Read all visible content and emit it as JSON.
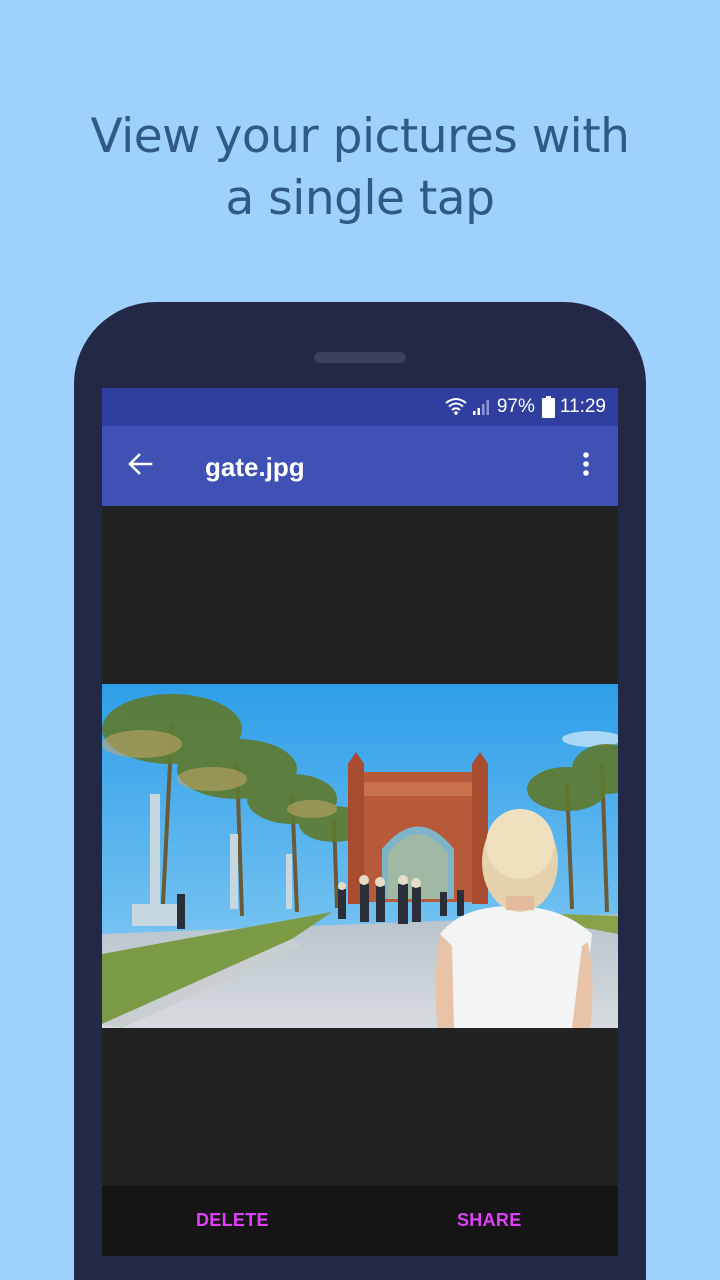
{
  "promo": {
    "line1": "View your pictures with",
    "line2": "a single tap"
  },
  "status_bar": {
    "battery_level": "97%",
    "time": "11:29",
    "icons": [
      "wifi-icon",
      "signal-icon",
      "battery-icon"
    ]
  },
  "app_bar": {
    "title": "gate.jpg",
    "back_icon": "arrow-back-icon",
    "menu_icon": "more-vert-icon"
  },
  "bottom_actions": {
    "delete_label": "DELETE",
    "share_label": "SHARE"
  },
  "colors": {
    "background": "#9fd1fd",
    "headline": "#2f5a86",
    "phone_body": "#232846",
    "status_bar": "#303f9f",
    "app_bar": "#3f51b5",
    "viewer_bg": "#222222",
    "action_text": "#e040fb"
  }
}
